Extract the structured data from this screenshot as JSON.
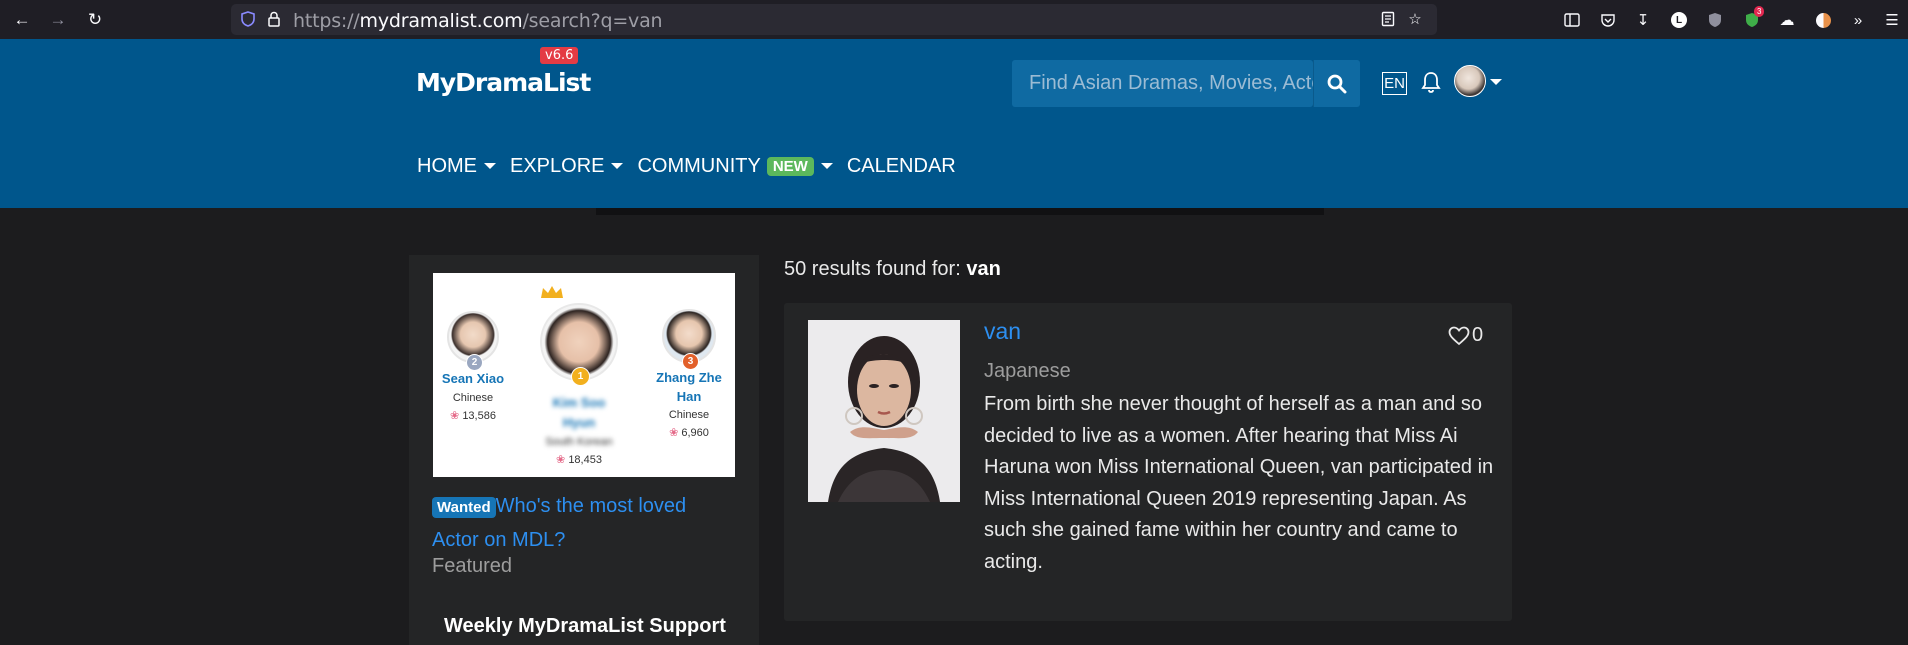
{
  "browser": {
    "url_scheme": "https://",
    "url_host": "mydramalist.com",
    "url_path": "/search?q=van",
    "badge_count": "3"
  },
  "header": {
    "logo": "MyDramaList",
    "version": "v6.6",
    "search_placeholder": "Find Asian Dramas, Movies, Actors and more...",
    "lang": "EN",
    "nav": [
      {
        "label": "HOME"
      },
      {
        "label": "EXPLORE"
      },
      {
        "label": "COMMUNITY",
        "badge": "NEW"
      },
      {
        "label": "CALENDAR"
      }
    ]
  },
  "sidebar": {
    "banner_actors": [
      {
        "name": "Sean Xiao",
        "nationality": "Chinese",
        "likes": "13,586",
        "rank": "2"
      },
      {
        "name": "Kim Soo Hyun",
        "nationality": "South Korean",
        "likes": "18,453",
        "rank": "1"
      },
      {
        "name": "Zhang Zhe Han",
        "nationality": "Chinese",
        "likes": "6,960",
        "rank": "3"
      }
    ],
    "wanted_badge": "Wanted",
    "wanted_title": "Who's the most loved Actor on MDL?",
    "featured": "Featured",
    "weekly": "Weekly MyDramaList Support"
  },
  "results": {
    "prefix": "50 results found for:",
    "query": "van",
    "items": [
      {
        "name": "van",
        "likes": "0",
        "nationality": "Japanese",
        "bio": "From birth she never thought of herself as a man and so decided to live as a women. After hearing that Miss Ai Haruna won Miss International Queen, van participated in Miss International Queen 2019 representing Japan. As such she gained fame within her country and came to acting."
      }
    ]
  },
  "colors": {
    "header_bg": "#00568c",
    "page_bg": "#1c1c1e",
    "card_bg": "#242526",
    "link": "#2d8ff0",
    "new_badge": "#5cb85c",
    "version_badge": "#e43b44"
  }
}
